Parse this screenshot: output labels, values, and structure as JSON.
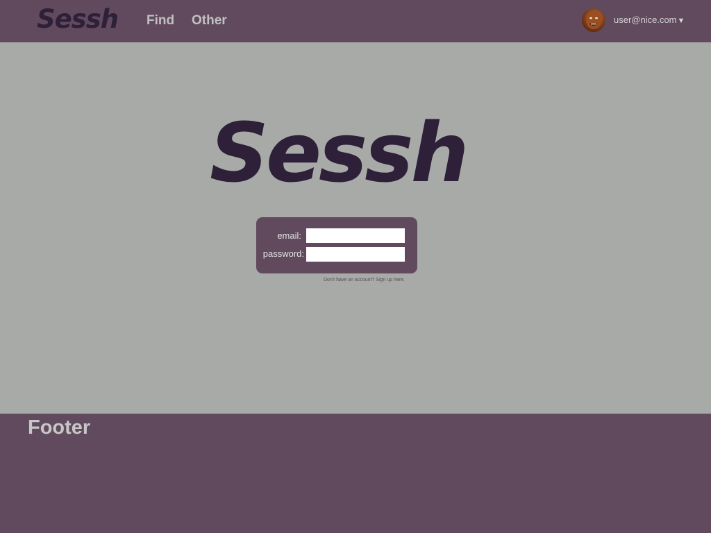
{
  "header": {
    "brand": "Sessh",
    "nav": [
      {
        "label": "Find"
      },
      {
        "label": "Other"
      }
    ],
    "user": {
      "email": "user@nice.com",
      "caret": "▼"
    }
  },
  "main": {
    "brand": "Sessh",
    "login": {
      "email_label": "email:",
      "password_label": "password:",
      "email_value": "",
      "password_value": ""
    },
    "signup_text": "Don't have an account? Sign up here."
  },
  "footer": {
    "title": "Footer"
  },
  "colors": {
    "header_bg": "#614a5e",
    "main_bg": "#a8aaa7",
    "brand": "#2d2038",
    "nav_text": "#c1c1c1"
  }
}
